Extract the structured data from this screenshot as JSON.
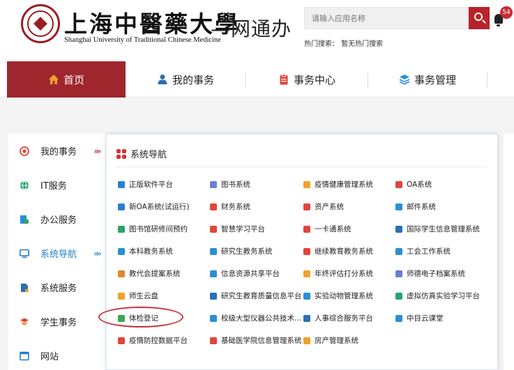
{
  "header": {
    "university_cn": "上海中醫藥大學",
    "university_en": "Shanghai University of Traditional Chinese Medicine",
    "portal_title": "—网通办",
    "search_placeholder": "请输入应用名称",
    "hot_search": "热门搜索：  暂无热门搜索",
    "notification_count": "54"
  },
  "nav": {
    "items": [
      {
        "label": "首页",
        "icon": "home-icon",
        "color": "#f0a12b"
      },
      {
        "label": "我的事务",
        "icon": "user-icon",
        "color": "#2a6fb5"
      },
      {
        "label": "事务中心",
        "icon": "clipboard-icon",
        "color": "#e2453c"
      },
      {
        "label": "事务管理",
        "icon": "layers-icon",
        "color": "#2a8fd6"
      }
    ]
  },
  "sidebar": {
    "items": [
      {
        "label": "我的事务",
        "icon": "target-icon",
        "color": "#e0453a",
        "arrow": "»»"
      },
      {
        "label": "IT服务",
        "icon": "globe-icon",
        "color": "#2aa36b",
        "arrow": ""
      },
      {
        "label": "办公服务",
        "icon": "office-icon",
        "color": "#3aa655",
        "arrow": ""
      },
      {
        "label": "系统导航",
        "icon": "monitor-icon",
        "color": "#1f7fc4",
        "arrow": "»»"
      },
      {
        "label": "系统服务",
        "icon": "document-icon",
        "color": "#2a6fb5",
        "arrow": ""
      },
      {
        "label": "学生事务",
        "icon": "student-icon",
        "color": "#e2453c",
        "arrow": ""
      },
      {
        "label": "网站",
        "icon": "window-icon",
        "color": "#1f7fc4",
        "arrow": ""
      }
    ]
  },
  "panel": {
    "title": "系统导航",
    "services": [
      [
        {
          "label": "正版软件平台",
          "color": "#2a7fd0"
        },
        {
          "label": "新OA系统(试运行)",
          "color": "#2a7fd0"
        },
        {
          "label": "图书馆研修间预约",
          "color": "#2aa36b"
        },
        {
          "label": "本科教务系统",
          "color": "#2a8fd6"
        },
        {
          "label": "教代会提案系统",
          "color": "#e08a2b"
        },
        {
          "label": "师生云盘",
          "color": "#f0a12b"
        },
        {
          "label": "体检登记",
          "color": "#3aa655"
        },
        {
          "label": "疫情防控数据平台",
          "color": "#e2453c"
        }
      ],
      [
        {
          "label": "图书系统",
          "color": "#6b7fd0"
        },
        {
          "label": "财务系统",
          "color": "#e2453c"
        },
        {
          "label": "智慧学习平台",
          "color": "#e2453c"
        },
        {
          "label": "研究生教务系统",
          "color": "#2a8fd6"
        },
        {
          "label": "信息资源共享平台",
          "color": "#2a8fd6"
        },
        {
          "label": "研究生教育质量信息平台",
          "color": "#2a6fb5"
        },
        {
          "label": "校级大型仪器公共技术...",
          "color": "#2a8fd6"
        },
        {
          "label": "基础医学院信息管理系统",
          "color": "#e2453c"
        }
      ],
      [
        {
          "label": "疫情健康管理系统",
          "color": "#f0a12b"
        },
        {
          "label": "资产系统",
          "color": "#e2453c"
        },
        {
          "label": "一卡通系统",
          "color": "#e2453c"
        },
        {
          "label": "继续教育教务系统",
          "color": "#e2453c"
        },
        {
          "label": "年终评估打分系统",
          "color": "#f0a12b"
        },
        {
          "label": "实验动物管理系统",
          "color": "#2a8fd6"
        },
        {
          "label": "人事综合服务平台",
          "color": "#2a6fb5"
        },
        {
          "label": "房产管理系统",
          "color": "#f0a12b"
        }
      ],
      [
        {
          "label": "OA系统",
          "color": "#e2453c"
        },
        {
          "label": "邮件系统",
          "color": "#2a8fd6"
        },
        {
          "label": "国际学生信息管理系统",
          "color": "#2a6fb5"
        },
        {
          "label": "工会工作系统",
          "color": "#2a8fd6"
        },
        {
          "label": "师德电子档案系统",
          "color": "#6b7fd0"
        },
        {
          "label": "虚拟仿真实验学习平台",
          "color": "#2aa36b"
        },
        {
          "label": "中目云课堂",
          "color": "#2a8fd6"
        }
      ]
    ]
  }
}
